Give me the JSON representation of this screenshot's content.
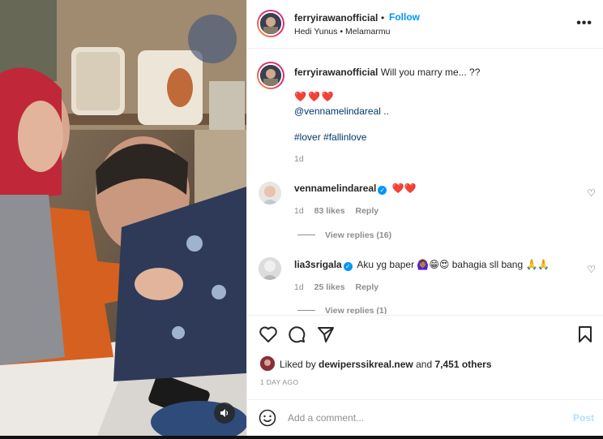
{
  "post": {
    "username": "ferryirawanofficial",
    "follow_label": "Follow",
    "subtitle": "Hedi Yunus • Melamarmu",
    "more_label": "•••"
  },
  "caption": {
    "username": "ferryirawanofficial",
    "text": "Will you marry me... ??",
    "hearts": "❤️❤️❤️",
    "mention": "@vennamelindareal",
    "mention_suffix": " ..",
    "hashtags": "#lover #fallinlove",
    "time": "1d"
  },
  "comments": [
    {
      "username": "vennamelindareal",
      "text": "❤️❤️",
      "verified": true,
      "time": "1d",
      "likes": "83 likes",
      "reply_label": "Reply",
      "view_replies": "View replies (16)"
    },
    {
      "username": "lia3srigala",
      "text": "Aku yg baper 🙆🏽‍♀️😁😍 bahagia sll bang 🙏🙏",
      "verified": true,
      "time": "1d",
      "likes": "25 likes",
      "reply_label": "Reply",
      "view_replies": "View replies (1)"
    }
  ],
  "actions": {
    "icons": [
      "heart-icon",
      "comment-icon",
      "share-icon",
      "bookmark-icon"
    ]
  },
  "likes": {
    "prefix": "Liked by ",
    "user": "dewiperssikreal.new",
    "middle": " and ",
    "others": "7,451 others"
  },
  "date": "1 DAY AGO",
  "add_comment": {
    "placeholder": "Add a comment...",
    "post_label": "Post"
  },
  "colors": {
    "accent": "#0095f6",
    "link": "#00376b",
    "heart_red": "#ed4956",
    "muted": "#8e8e8e"
  }
}
